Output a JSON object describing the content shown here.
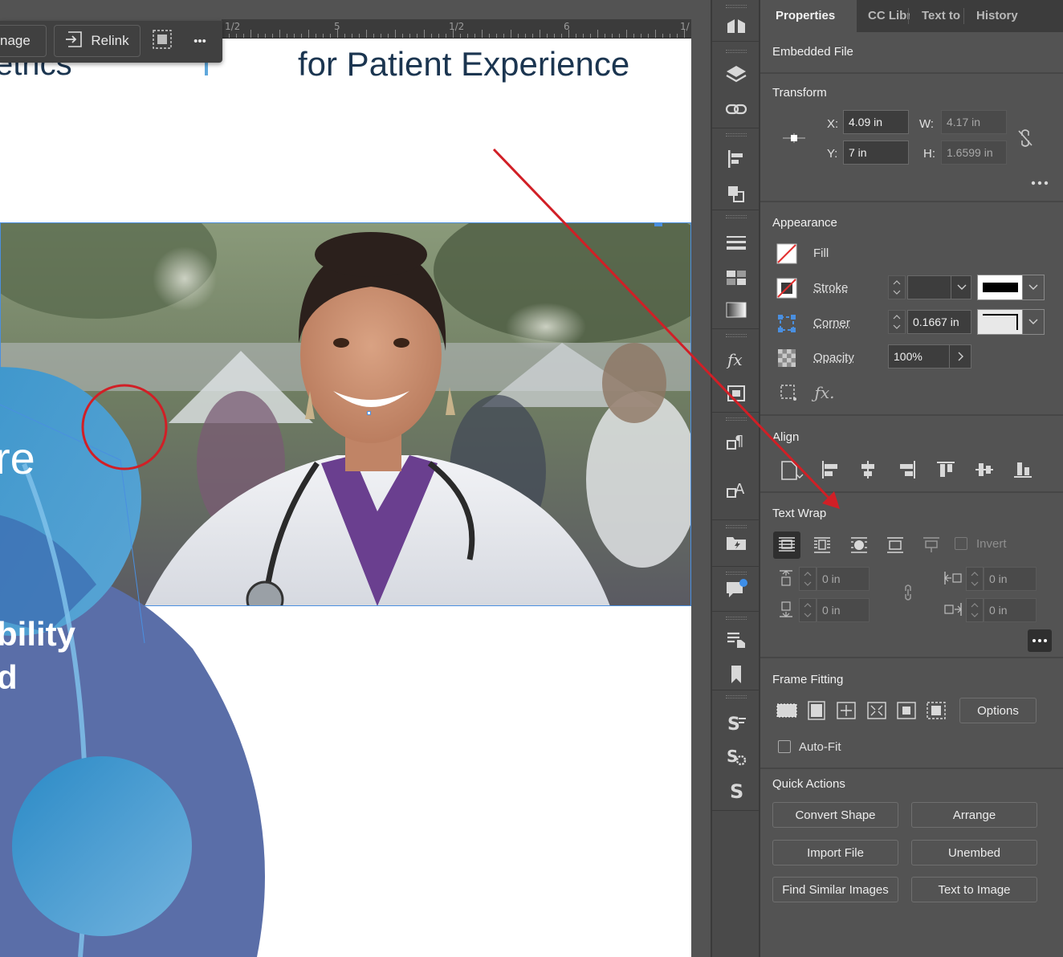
{
  "context_bar": {
    "image_label": "nage",
    "relink_label": "Relink",
    "more_label": "•••"
  },
  "ruler": {
    "labels": [
      "1/2",
      "5",
      "1/2",
      "6",
      "1/"
    ]
  },
  "document": {
    "heading_left": "etrics",
    "heading_right": "for Patient Experience",
    "blob_text_1": "re",
    "blob_text_2": "bility",
    "blob_text_3": "d",
    "colors": {
      "blob_light": "#4a9ccf",
      "blob_dark": "#5a6ea8",
      "blob_mid": "#3572b8",
      "selection": "#4a8fe0",
      "heading": "#1b3550"
    }
  },
  "tools": {
    "icons": [
      "cc-libraries-icon",
      "layers-icon",
      "links-icon",
      "align-icon",
      "pathfinder-icon",
      "stroke-icon",
      "swatches-icon",
      "gradient-icon",
      "effects-icon",
      "transform-frame-icon",
      "paragraph-styles-icon",
      "character-styles-icon",
      "content-collector-icon",
      "comments-icon",
      "interactive-icon",
      "bookmarks-icon",
      "script-icon",
      "script-settings-icon",
      "scripting-icon"
    ]
  },
  "panel": {
    "tabs": [
      "Properties",
      "CC Libr",
      "Text to",
      "History"
    ],
    "embedded_file": "Embedded File",
    "transform": {
      "title": "Transform",
      "x_label": "X:",
      "x_value": "4.09 in",
      "y_label": "Y:",
      "y_value": "7 in",
      "w_label": "W:",
      "w_value": "4.17 in",
      "h_label": "H:",
      "h_value": "1.6599 in"
    },
    "appearance": {
      "title": "Appearance",
      "fill_label": "Fill",
      "stroke_label": "Stroke",
      "corner_label": "Corner",
      "corner_value": "0.1667 in",
      "opacity_label": "Opacity",
      "opacity_value": "100%"
    },
    "align": {
      "title": "Align"
    },
    "text_wrap": {
      "title": "Text Wrap",
      "invert_label": "Invert",
      "top_value": "0 in",
      "bottom_value": "0 in",
      "left_value": "0 in",
      "right_value": "0 in"
    },
    "frame_fitting": {
      "title": "Frame Fitting",
      "options_label": "Options",
      "autofit_label": "Auto-Fit"
    },
    "quick_actions": {
      "title": "Quick Actions",
      "convert_shape": "Convert Shape",
      "arrange": "Arrange",
      "import_file": "Import File",
      "unembed": "Unembed",
      "find_similar": "Find Similar Images",
      "text_to_image": "Text to Image"
    }
  }
}
